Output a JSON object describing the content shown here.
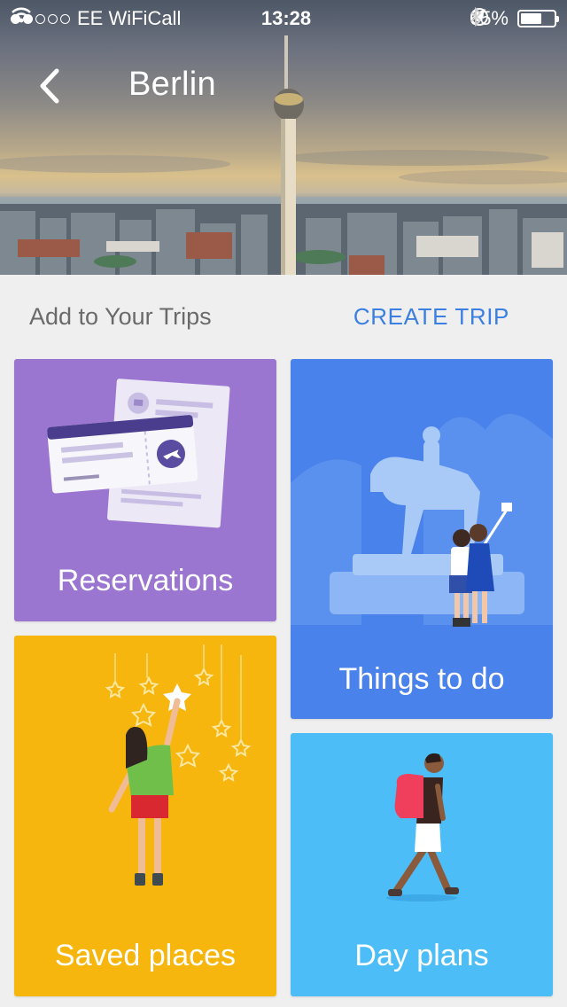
{
  "status_bar": {
    "carrier": "EE WiFiCall",
    "time": "13:28",
    "battery": "65%",
    "battery_level": 0.65,
    "signal_dots_filled": 2,
    "signal_dots_total": 5,
    "icons": [
      "wifi-icon",
      "rotation-lock-icon",
      "location-arrow-icon",
      "bluetooth-icon",
      "battery-icon"
    ]
  },
  "nav": {
    "title": "Berlin",
    "back_icon": "chevron-left-icon"
  },
  "section": {
    "label": "Add to Your Trips",
    "action": "CREATE TRIP"
  },
  "cards": {
    "reservations": {
      "label": "Reservations",
      "color": "#9b76d0"
    },
    "things_to_do": {
      "label": "Things to do",
      "color": "#4a82eb"
    },
    "saved_places": {
      "label": "Saved places",
      "color": "#f7b60d"
    },
    "day_plans": {
      "label": "Day plans",
      "color": "#4cbdf7"
    }
  },
  "colors": {
    "accent": "#3b7fe0",
    "background": "#efefef"
  }
}
